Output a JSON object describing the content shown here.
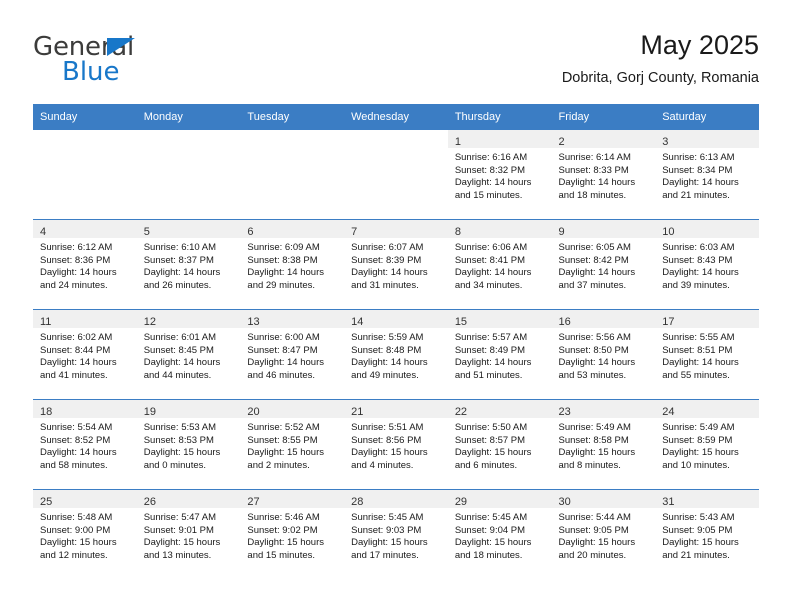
{
  "brand": {
    "name_top": "General",
    "name_bottom": "Blue",
    "logo_icon": "triangle-flag-icon",
    "accent_color": "#1877c9"
  },
  "header": {
    "title": "May 2025",
    "subtitle": "Dobrita, Gorj County, Romania"
  },
  "calendar": {
    "header_color": "#3b7dc4",
    "weekdays": [
      "Sunday",
      "Monday",
      "Tuesday",
      "Wednesday",
      "Thursday",
      "Friday",
      "Saturday"
    ],
    "weeks": [
      [
        {
          "day": "",
          "empty": true
        },
        {
          "day": "",
          "empty": true
        },
        {
          "day": "",
          "empty": true
        },
        {
          "day": "",
          "empty": true
        },
        {
          "day": "1",
          "sunrise": "Sunrise: 6:16 AM",
          "sunset": "Sunset: 8:32 PM",
          "daylight_1": "Daylight: 14 hours",
          "daylight_2": "and 15 minutes."
        },
        {
          "day": "2",
          "sunrise": "Sunrise: 6:14 AM",
          "sunset": "Sunset: 8:33 PM",
          "daylight_1": "Daylight: 14 hours",
          "daylight_2": "and 18 minutes."
        },
        {
          "day": "3",
          "sunrise": "Sunrise: 6:13 AM",
          "sunset": "Sunset: 8:34 PM",
          "daylight_1": "Daylight: 14 hours",
          "daylight_2": "and 21 minutes."
        }
      ],
      [
        {
          "day": "4",
          "sunrise": "Sunrise: 6:12 AM",
          "sunset": "Sunset: 8:36 PM",
          "daylight_1": "Daylight: 14 hours",
          "daylight_2": "and 24 minutes."
        },
        {
          "day": "5",
          "sunrise": "Sunrise: 6:10 AM",
          "sunset": "Sunset: 8:37 PM",
          "daylight_1": "Daylight: 14 hours",
          "daylight_2": "and 26 minutes."
        },
        {
          "day": "6",
          "sunrise": "Sunrise: 6:09 AM",
          "sunset": "Sunset: 8:38 PM",
          "daylight_1": "Daylight: 14 hours",
          "daylight_2": "and 29 minutes."
        },
        {
          "day": "7",
          "sunrise": "Sunrise: 6:07 AM",
          "sunset": "Sunset: 8:39 PM",
          "daylight_1": "Daylight: 14 hours",
          "daylight_2": "and 31 minutes."
        },
        {
          "day": "8",
          "sunrise": "Sunrise: 6:06 AM",
          "sunset": "Sunset: 8:41 PM",
          "daylight_1": "Daylight: 14 hours",
          "daylight_2": "and 34 minutes."
        },
        {
          "day": "9",
          "sunrise": "Sunrise: 6:05 AM",
          "sunset": "Sunset: 8:42 PM",
          "daylight_1": "Daylight: 14 hours",
          "daylight_2": "and 37 minutes."
        },
        {
          "day": "10",
          "sunrise": "Sunrise: 6:03 AM",
          "sunset": "Sunset: 8:43 PM",
          "daylight_1": "Daylight: 14 hours",
          "daylight_2": "and 39 minutes."
        }
      ],
      [
        {
          "day": "11",
          "sunrise": "Sunrise: 6:02 AM",
          "sunset": "Sunset: 8:44 PM",
          "daylight_1": "Daylight: 14 hours",
          "daylight_2": "and 41 minutes."
        },
        {
          "day": "12",
          "sunrise": "Sunrise: 6:01 AM",
          "sunset": "Sunset: 8:45 PM",
          "daylight_1": "Daylight: 14 hours",
          "daylight_2": "and 44 minutes."
        },
        {
          "day": "13",
          "sunrise": "Sunrise: 6:00 AM",
          "sunset": "Sunset: 8:47 PM",
          "daylight_1": "Daylight: 14 hours",
          "daylight_2": "and 46 minutes."
        },
        {
          "day": "14",
          "sunrise": "Sunrise: 5:59 AM",
          "sunset": "Sunset: 8:48 PM",
          "daylight_1": "Daylight: 14 hours",
          "daylight_2": "and 49 minutes."
        },
        {
          "day": "15",
          "sunrise": "Sunrise: 5:57 AM",
          "sunset": "Sunset: 8:49 PM",
          "daylight_1": "Daylight: 14 hours",
          "daylight_2": "and 51 minutes."
        },
        {
          "day": "16",
          "sunrise": "Sunrise: 5:56 AM",
          "sunset": "Sunset: 8:50 PM",
          "daylight_1": "Daylight: 14 hours",
          "daylight_2": "and 53 minutes."
        },
        {
          "day": "17",
          "sunrise": "Sunrise: 5:55 AM",
          "sunset": "Sunset: 8:51 PM",
          "daylight_1": "Daylight: 14 hours",
          "daylight_2": "and 55 minutes."
        }
      ],
      [
        {
          "day": "18",
          "sunrise": "Sunrise: 5:54 AM",
          "sunset": "Sunset: 8:52 PM",
          "daylight_1": "Daylight: 14 hours",
          "daylight_2": "and 58 minutes."
        },
        {
          "day": "19",
          "sunrise": "Sunrise: 5:53 AM",
          "sunset": "Sunset: 8:53 PM",
          "daylight_1": "Daylight: 15 hours",
          "daylight_2": "and 0 minutes."
        },
        {
          "day": "20",
          "sunrise": "Sunrise: 5:52 AM",
          "sunset": "Sunset: 8:55 PM",
          "daylight_1": "Daylight: 15 hours",
          "daylight_2": "and 2 minutes."
        },
        {
          "day": "21",
          "sunrise": "Sunrise: 5:51 AM",
          "sunset": "Sunset: 8:56 PM",
          "daylight_1": "Daylight: 15 hours",
          "daylight_2": "and 4 minutes."
        },
        {
          "day": "22",
          "sunrise": "Sunrise: 5:50 AM",
          "sunset": "Sunset: 8:57 PM",
          "daylight_1": "Daylight: 15 hours",
          "daylight_2": "and 6 minutes."
        },
        {
          "day": "23",
          "sunrise": "Sunrise: 5:49 AM",
          "sunset": "Sunset: 8:58 PM",
          "daylight_1": "Daylight: 15 hours",
          "daylight_2": "and 8 minutes."
        },
        {
          "day": "24",
          "sunrise": "Sunrise: 5:49 AM",
          "sunset": "Sunset: 8:59 PM",
          "daylight_1": "Daylight: 15 hours",
          "daylight_2": "and 10 minutes."
        }
      ],
      [
        {
          "day": "25",
          "sunrise": "Sunrise: 5:48 AM",
          "sunset": "Sunset: 9:00 PM",
          "daylight_1": "Daylight: 15 hours",
          "daylight_2": "and 12 minutes."
        },
        {
          "day": "26",
          "sunrise": "Sunrise: 5:47 AM",
          "sunset": "Sunset: 9:01 PM",
          "daylight_1": "Daylight: 15 hours",
          "daylight_2": "and 13 minutes."
        },
        {
          "day": "27",
          "sunrise": "Sunrise: 5:46 AM",
          "sunset": "Sunset: 9:02 PM",
          "daylight_1": "Daylight: 15 hours",
          "daylight_2": "and 15 minutes."
        },
        {
          "day": "28",
          "sunrise": "Sunrise: 5:45 AM",
          "sunset": "Sunset: 9:03 PM",
          "daylight_1": "Daylight: 15 hours",
          "daylight_2": "and 17 minutes."
        },
        {
          "day": "29",
          "sunrise": "Sunrise: 5:45 AM",
          "sunset": "Sunset: 9:04 PM",
          "daylight_1": "Daylight: 15 hours",
          "daylight_2": "and 18 minutes."
        },
        {
          "day": "30",
          "sunrise": "Sunrise: 5:44 AM",
          "sunset": "Sunset: 9:05 PM",
          "daylight_1": "Daylight: 15 hours",
          "daylight_2": "and 20 minutes."
        },
        {
          "day": "31",
          "sunrise": "Sunrise: 5:43 AM",
          "sunset": "Sunset: 9:05 PM",
          "daylight_1": "Daylight: 15 hours",
          "daylight_2": "and 21 minutes."
        }
      ]
    ]
  }
}
